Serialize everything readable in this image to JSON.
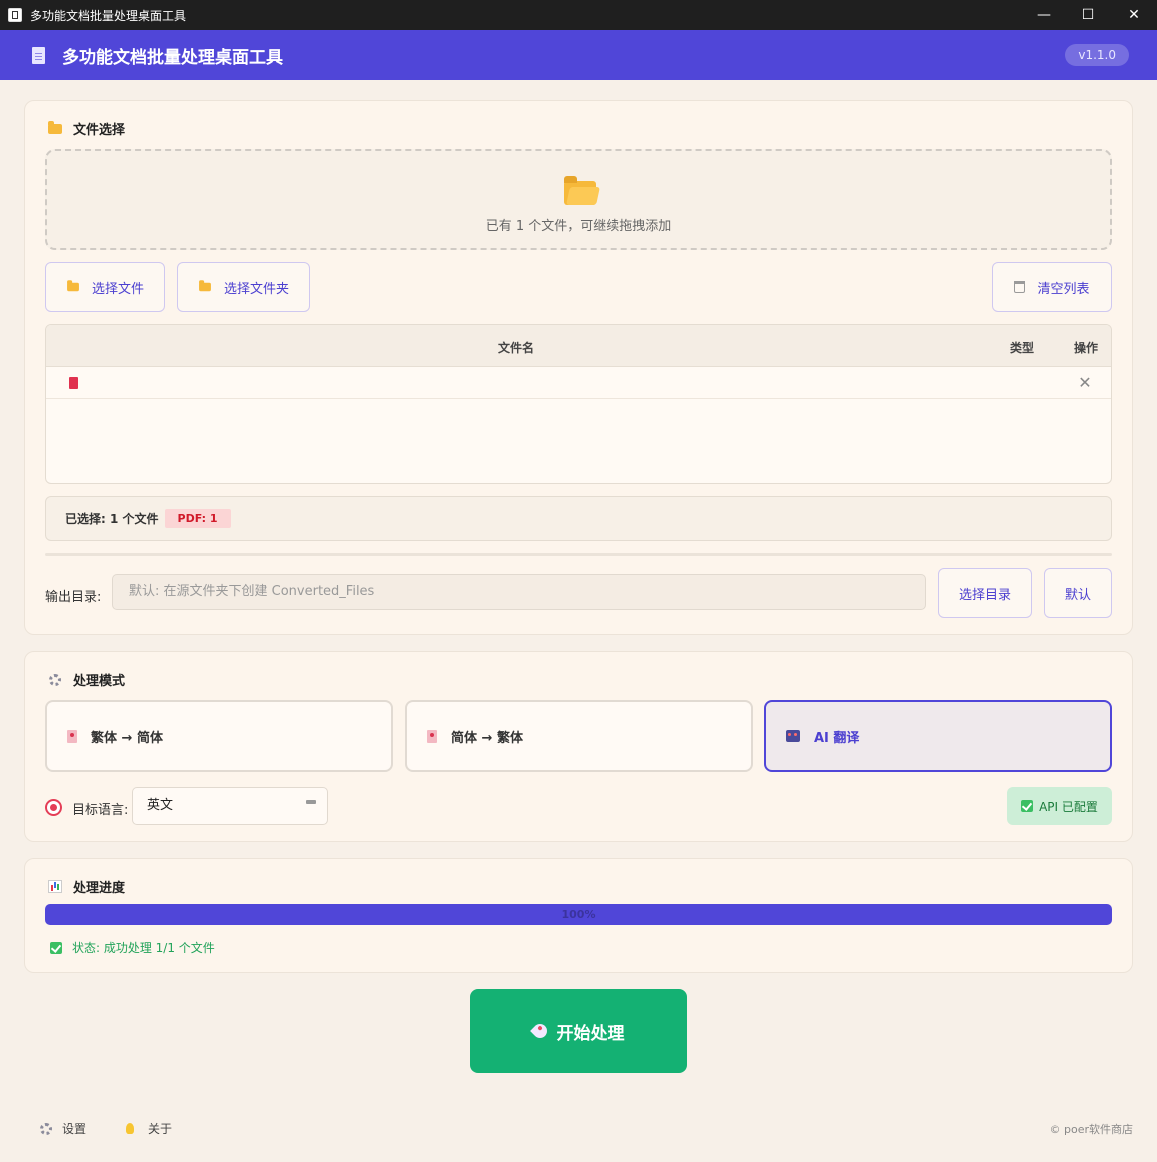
{
  "window": {
    "title": "多功能文档批量处理桌面工具",
    "controls": {
      "minimize": "—",
      "maximize": "☐",
      "close": "✕"
    }
  },
  "header": {
    "title": "多功能文档批量处理桌面工具",
    "version": "v1.1.0"
  },
  "file_section": {
    "title": "文件选择",
    "drop_hint": "已有 1 个文件，可继续拖拽添加",
    "buttons": {
      "select_files": "选择文件",
      "select_folder": "选择文件夹",
      "clear_list": "清空列表"
    },
    "table": {
      "columns": [
        "文件名",
        "类型",
        "操作"
      ],
      "rows": [
        {
          "name": "",
          "type": "",
          "icon": "pdf-icon",
          "action": "✕"
        }
      ]
    },
    "selection": {
      "text": "已选择: 1 个文件",
      "badge": "PDF: 1"
    },
    "output": {
      "label": "输出目录:",
      "placeholder": "默认: 在源文件夹下创建 Converted_Files",
      "value": "",
      "choose": "选择目录",
      "default": "默认"
    }
  },
  "mode_section": {
    "title": "处理模式",
    "modes": [
      {
        "label": "繁体 → 简体",
        "active": false
      },
      {
        "label": "简体 → 繁体",
        "active": false
      },
      {
        "label": "AI 翻译",
        "active": true
      }
    ],
    "target_language": {
      "label": "目标语言:",
      "value": "英文"
    },
    "api_status": "API 已配置"
  },
  "progress_section": {
    "title": "处理进度",
    "percent": 100,
    "percent_label": "100%",
    "status": "状态: 成功处理 1/1 个文件"
  },
  "start_button": "开始处理",
  "footer": {
    "settings": "设置",
    "about": "关于",
    "copyright": "© poer软件商店"
  },
  "colors": {
    "accent": "#5046d8",
    "start": "#14b173",
    "pdf_badge": "#d11a2a",
    "success": "#22a35a"
  }
}
